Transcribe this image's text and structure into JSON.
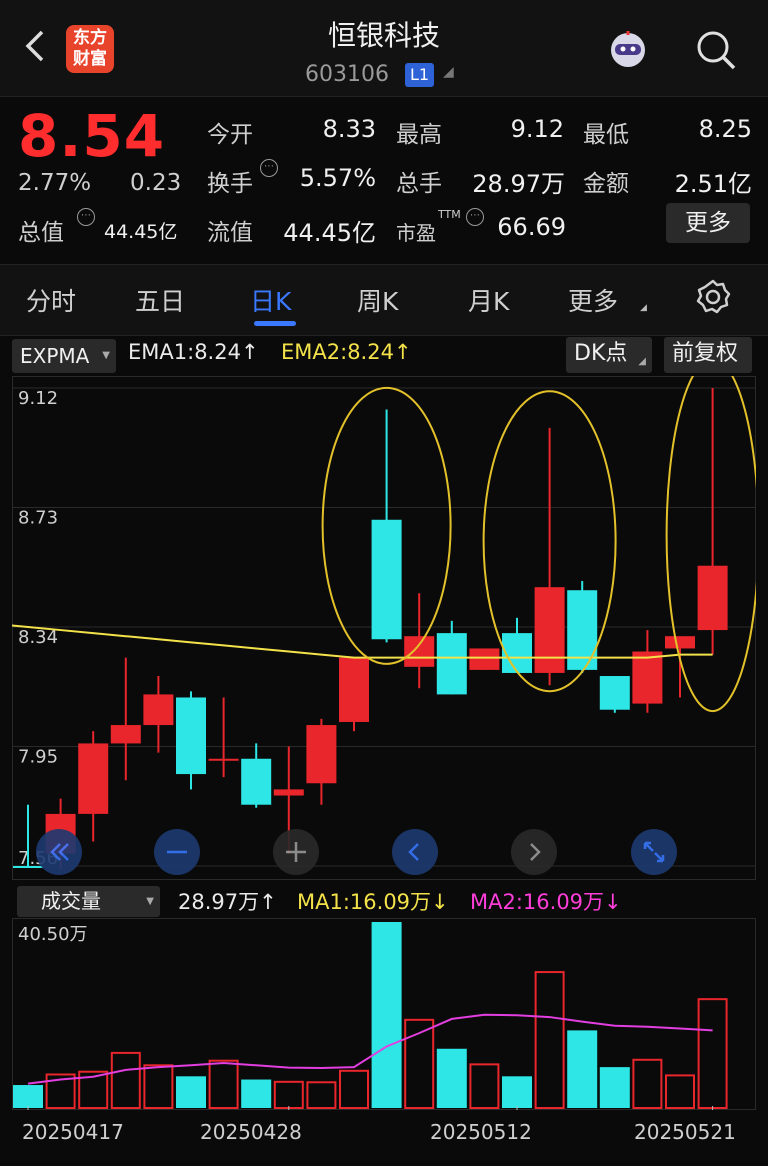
{
  "header": {
    "back_icon": "chevron-left-icon",
    "logo_text": "东方\n财富",
    "title": "恒银科技",
    "code": "603106",
    "level": "L1",
    "robot_icon": "robot-avatar-icon",
    "search_icon": "search-icon"
  },
  "quote": {
    "price": "8.54",
    "change_pct": "2.77%",
    "change": "0.23",
    "total_value_label": "总值",
    "total_value": "44.45亿",
    "open_label": "今开",
    "open": "8.33",
    "high_label": "最高",
    "high": "9.12",
    "low_label": "最低",
    "low": "8.25",
    "turnover_label": "换手",
    "turnover": "5.57%",
    "volume_label": "总手",
    "volume": "28.97万",
    "amount_label": "金额",
    "amount": "2.51亿",
    "float_label": "流值",
    "float_value": "44.45亿",
    "pe_label": "市盈",
    "pe_sup": "TTM",
    "pe": "66.69",
    "more_button": "更多",
    "colors": {
      "up": "#ff3333",
      "down": "#21c04a"
    }
  },
  "tabs": {
    "items": [
      "分时",
      "五日",
      "日K",
      "周K",
      "月K",
      "更多"
    ],
    "active": "日K",
    "settings_icon": "gear-icon"
  },
  "indicator": {
    "selector": "EXPMA",
    "ema1": "EMA1:8.24↑",
    "ema2": "EMA2:8.24↑",
    "dk_button": "DK点",
    "adjust_button": "前复权"
  },
  "controls": {
    "icons": [
      "double-chevron-left-icon",
      "zoom-out-icon",
      "zoom-in-icon",
      "chevron-left-icon",
      "chevron-right-icon",
      "expand-icon"
    ]
  },
  "volume": {
    "selector": "成交量",
    "vol": "28.97万↑",
    "ma1": "MA1:16.09万↓",
    "ma2": "MA2:16.09万↓",
    "max_label": "40.50万"
  },
  "dates": [
    "20250417",
    "20250428",
    "20250512",
    "20250521"
  ],
  "chart_data": {
    "type": "candlestick",
    "y_ticks": [
      "9.12",
      "8.73",
      "8.34",
      "7.95",
      "7.56"
    ],
    "ylim": [
      7.56,
      9.12
    ],
    "colors": {
      "up": "#e8262b",
      "down": "#2ee6e6",
      "ema": "#f3e24a",
      "ma2": "#e23ee0"
    },
    "candles": [
      {
        "o": 7.56,
        "h": 7.76,
        "l": 7.56,
        "c": 7.56,
        "up": false
      },
      {
        "o": 7.6,
        "h": 7.78,
        "l": 7.55,
        "c": 7.73,
        "up": true
      },
      {
        "o": 7.73,
        "h": 8.0,
        "l": 7.64,
        "c": 7.96,
        "up": true
      },
      {
        "o": 7.96,
        "h": 8.24,
        "l": 7.84,
        "c": 8.02,
        "up": true
      },
      {
        "o": 8.02,
        "h": 8.18,
        "l": 7.93,
        "c": 8.12,
        "up": true
      },
      {
        "o": 8.11,
        "h": 8.13,
        "l": 7.81,
        "c": 7.86,
        "up": false
      },
      {
        "o": 7.91,
        "h": 8.11,
        "l": 7.85,
        "c": 7.91,
        "up": true
      },
      {
        "o": 7.91,
        "h": 7.96,
        "l": 7.75,
        "c": 7.76,
        "up": false
      },
      {
        "o": 7.79,
        "h": 7.95,
        "l": 7.6,
        "c": 7.81,
        "up": true
      },
      {
        "o": 7.83,
        "h": 8.04,
        "l": 7.76,
        "c": 8.02,
        "up": true
      },
      {
        "o": 8.03,
        "h": 8.24,
        "l": 8.0,
        "c": 8.24,
        "up": true
      },
      {
        "o": 8.69,
        "h": 9.05,
        "l": 8.29,
        "c": 8.3,
        "up": false
      },
      {
        "o": 8.21,
        "h": 8.45,
        "l": 8.14,
        "c": 8.31,
        "up": true
      },
      {
        "o": 8.32,
        "h": 8.36,
        "l": 8.12,
        "c": 8.12,
        "up": false
      },
      {
        "o": 8.2,
        "h": 8.27,
        "l": 8.2,
        "c": 8.27,
        "up": true
      },
      {
        "o": 8.32,
        "h": 8.37,
        "l": 8.21,
        "c": 8.19,
        "up": false
      },
      {
        "o": 8.19,
        "h": 8.99,
        "l": 8.15,
        "c": 8.47,
        "up": true
      },
      {
        "o": 8.46,
        "h": 8.49,
        "l": 8.19,
        "c": 8.2,
        "up": false
      },
      {
        "o": 8.18,
        "h": 8.18,
        "l": 8.06,
        "c": 8.07,
        "up": false
      },
      {
        "o": 8.09,
        "h": 8.33,
        "l": 8.06,
        "c": 8.26,
        "up": true
      },
      {
        "o": 8.27,
        "h": 8.29,
        "l": 8.11,
        "c": 8.31,
        "up": true
      },
      {
        "o": 8.33,
        "h": 9.12,
        "l": 8.25,
        "c": 8.54,
        "up": true
      }
    ],
    "ema": [
      8.34,
      8.33,
      8.32,
      8.31,
      8.3,
      8.29,
      8.28,
      8.27,
      8.26,
      8.25,
      8.24,
      8.24,
      8.24,
      8.24,
      8.24,
      8.24,
      8.24,
      8.24,
      8.24,
      8.24,
      8.25,
      8.25
    ],
    "volume_ylim": [
      0,
      40.5
    ],
    "volume_values": [
      5.0,
      7.3,
      7.9,
      12.0,
      9.3,
      6.9,
      10.3,
      6.2,
      5.7,
      5.6,
      8.1,
      40.5,
      19.2,
      12.9,
      9.5,
      6.9,
      29.6,
      16.9,
      8.9,
      10.5,
      7.1,
      23.7
    ],
    "ma_line": [
      5.3,
      6.2,
      6.8,
      8.3,
      8.9,
      9.3,
      9.8,
      9.3,
      8.8,
      8.7,
      8.9,
      13.4,
      16.3,
      19.4,
      20.3,
      20.2,
      19.8,
      18.8,
      17.9,
      17.7,
      17.3,
      16.9
    ]
  }
}
